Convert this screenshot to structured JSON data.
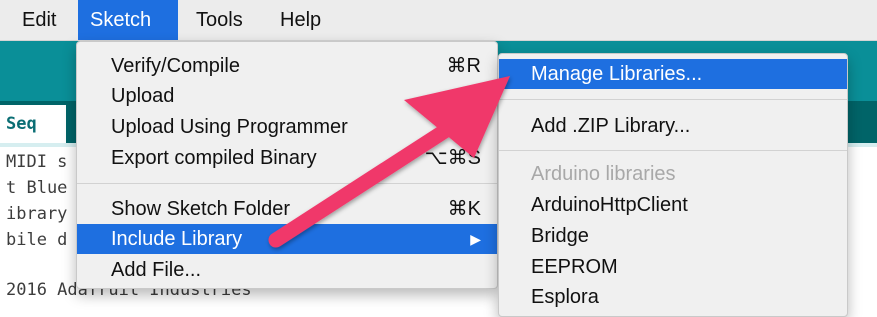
{
  "menubar": {
    "items": [
      {
        "label": "Edit"
      },
      {
        "label": "Sketch"
      },
      {
        "label": "Tools"
      },
      {
        "label": "Help"
      }
    ]
  },
  "editor": {
    "tab_label": "Seq",
    "code_lines": [
      "MIDI s",
      "t Blue",
      "ibrary",
      "bile d",
      "",
      "2016 Adafruit Industries"
    ]
  },
  "sketch_menu": {
    "items": [
      {
        "label": "Verify/Compile",
        "shortcut": "⌘R"
      },
      {
        "label": "Upload",
        "shortcut": ""
      },
      {
        "label": "Upload Using Programmer",
        "shortcut": ""
      },
      {
        "label": "Export compiled Binary",
        "shortcut": "⌥⌘S"
      },
      {
        "label": "Show Sketch Folder",
        "shortcut": "⌘K"
      },
      {
        "label": "Include Library",
        "shortcut": "▶"
      },
      {
        "label": "Add File...",
        "shortcut": ""
      }
    ]
  },
  "library_menu": {
    "manage": "Manage Libraries...",
    "add_zip": "Add .ZIP Library...",
    "section_header": "Arduino libraries",
    "libraries": [
      "ArduinoHttpClient",
      "Bridge",
      "EEPROM",
      "Esplora"
    ]
  },
  "colors": {
    "highlight": "#1e6fe0",
    "toolbar": "#0a8f98",
    "arrow": "#f0386b"
  }
}
